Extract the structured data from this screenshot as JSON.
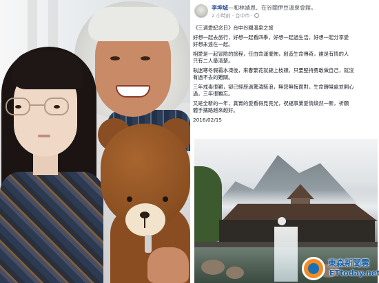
{
  "post": {
    "author": "李坤城",
    "with_text": "—和林靖恩、在谷關伊豆溫泉會館。",
    "time": "2 小時前 · 台中市 ·",
    "paragraphs": [
      "《三週愛紀念日》台中谷關溫泉之旅",
      "好想一起去旅行，好想一起看四季，好想一起過生活，好想一起分享愛\n好想永遠在一起。",
      "相愛是一起冒險的旅程，任由命運擺佈，創造生命傳奇，誰是有情的人\n只有二人最清楚。",
      "執迷寒冬假霜水凍後，來春繁花就錦上枝頭，只要堅持勇敢做自己，就沒\n有過不去的難關。",
      "三年戒毒很艱，卻已經歷過驚濤駭浪，無怨無悔面對，生命轉彎處並開心\n過，三年很難忘。",
      "又是全新的一年，真實的愛看得見亮光，祝福事業愛情煥然一新，祈願\n體手攜路越來越好。"
    ],
    "date": "2016/02/15"
  },
  "watermark": {
    "cn": "東森新聞雲",
    "en": "ETtoday.net"
  },
  "colors": {
    "author_link": "#365899",
    "meta_gray": "#90949c",
    "watermark_blue": "#1b5fa8",
    "watermark_orange": "#f28b24"
  }
}
